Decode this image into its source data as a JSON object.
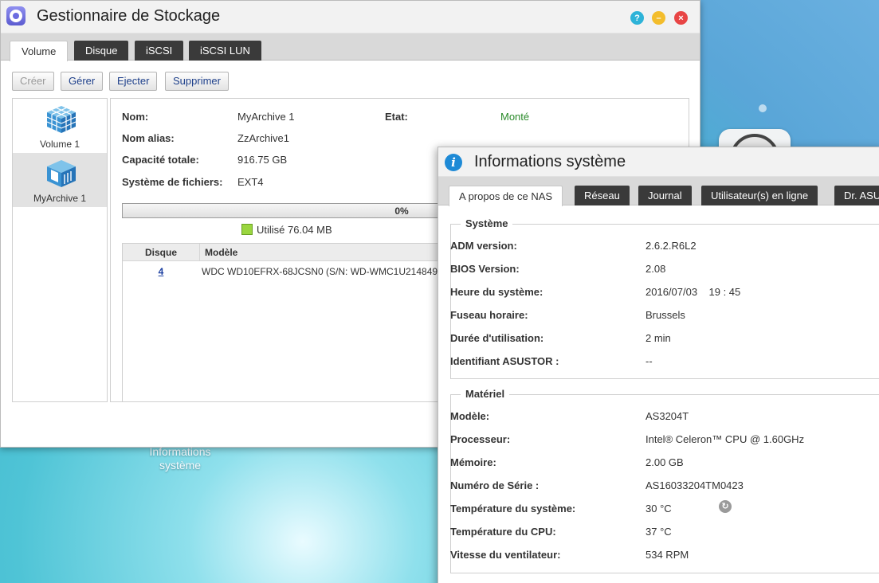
{
  "desktop": {
    "icon_label_line1": "Informations",
    "icon_label_line2": "système"
  },
  "storage_window": {
    "title": "Gestionnaire de Stockage",
    "tabs": [
      {
        "label": "Volume",
        "active": true
      },
      {
        "label": "Disque",
        "active": false
      },
      {
        "label": "iSCSI",
        "active": false
      },
      {
        "label": "iSCSI LUN",
        "active": false
      }
    ],
    "toolbar": {
      "create_label": "Créer",
      "manage_label": "Gérer",
      "eject_label": "Ejecter",
      "delete_label": "Supprimer"
    },
    "volumes": [
      {
        "label": "Volume 1",
        "selected": false
      },
      {
        "label": "MyArchive 1",
        "selected": true
      }
    ],
    "details": {
      "name_label": "Nom:",
      "name_value": "MyArchive 1",
      "state_label": "Etat:",
      "state_value": "Monté",
      "alias_label": "Nom alias:",
      "alias_value": "ZzArchive1",
      "capacity_label": "Capacité totale:",
      "capacity_value": "916.75 GB",
      "fs_label": "Système de fichiers:",
      "fs_value": "EXT4"
    },
    "usage": {
      "percent_text": "0%",
      "fraction": 0.0,
      "legend_text": "Utilisé 76.04 MB",
      "color": "#9ad63f"
    },
    "disk_table": {
      "col_disk": "Disque",
      "col_model": "Modèle",
      "rows": [
        {
          "disk": "4",
          "model": "WDC WD10EFRX-68JCSN0 (S/N: WD-WMC1U214849"
        }
      ]
    }
  },
  "sysinfo_window": {
    "title": "Informations système",
    "tabs": [
      {
        "label": "A propos de ce NAS",
        "active": true
      },
      {
        "label": "Réseau",
        "active": false
      },
      {
        "label": "Journal",
        "active": false
      },
      {
        "label": "Utilisateur(s) en ligne",
        "active": false
      },
      {
        "label": "Dr. ASU",
        "active": false
      }
    ],
    "system": {
      "legend": "Système",
      "rows": [
        {
          "key": "ADM version:",
          "value": "2.6.2.R6L2"
        },
        {
          "key": "BIOS Version:",
          "value": "2.08"
        },
        {
          "key": "Heure du système:",
          "value": "2016/07/03    19 : 45"
        },
        {
          "key": "Fuseau horaire:",
          "value": "Brussels"
        },
        {
          "key": "Durée d'utilisation:",
          "value": "2 min"
        },
        {
          "key": "Identifiant ASUSTOR :",
          "value": "--"
        }
      ]
    },
    "hardware": {
      "legend": "Matériel",
      "rows": [
        {
          "key": "Modèle:",
          "value": "AS3204T"
        },
        {
          "key": "Processeur:",
          "value": "Intel® Celeron™ CPU @ 1.60GHz"
        },
        {
          "key": "Mémoire:",
          "value": "2.00 GB"
        },
        {
          "key": "Numéro de Série :",
          "value": "AS16033204TM0423"
        },
        {
          "key": "Température du système:",
          "value": "30 °C"
        },
        {
          "key": "Température du CPU:",
          "value": "37 °C"
        },
        {
          "key": "Vitesse du ventilateur:",
          "value": "534 RPM"
        }
      ]
    }
  }
}
